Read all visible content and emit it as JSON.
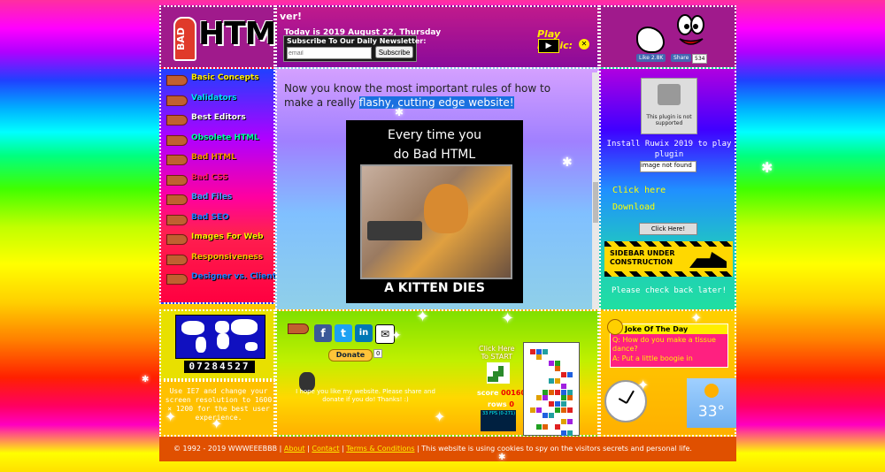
{
  "header": {
    "logo_badge": "BAD",
    "logo_word": "HTML",
    "scroll_text": "ver!",
    "date_text": "Today is 2019 August 22, Thursday",
    "newsletter": {
      "title": "Subscribe To Our Daily Newsletter:",
      "placeholder": "email",
      "button": "Subscribe"
    },
    "music_label": "Play Music:",
    "play_icon": "play-icon",
    "stop_icon": "close-icon",
    "like_label": "Like 2.8K",
    "share_label": "Share",
    "share_count": "534"
  },
  "nav": {
    "items": [
      {
        "label": "Basic Concepts",
        "color": "#ffee00"
      },
      {
        "label": "Validators",
        "color": "#00e0ff"
      },
      {
        "label": "Best Editors",
        "color": "#ffffff"
      },
      {
        "label": "Obsolete HTML",
        "color": "#00ffa0"
      },
      {
        "label": "Bad HTML",
        "color": "#ff9000"
      },
      {
        "label": "Bad CSS",
        "color": "#ff2060"
      },
      {
        "label": "Bad Files",
        "color": "#40a0ff"
      },
      {
        "label": "Bad SEO",
        "color": "#2080ff"
      },
      {
        "label": "Images For Web",
        "color": "#ffee00"
      },
      {
        "label": "Responsiveness",
        "color": "#ffc000"
      },
      {
        "label": "Designer vs. Client",
        "color": "#2080ff"
      }
    ]
  },
  "main": {
    "intro_plain": "Now you know the most important rules of how to make a really ",
    "intro_highlight": "flashy, cutting edge website!",
    "meme_top_1": "Every time you",
    "meme_top_2": "do Bad HTML",
    "meme_bottom": "A KITTEN DIES"
  },
  "sidebar": {
    "plugin_text": "This plugin is not supported",
    "install_text": "Install Ruwix 2019 to play plugin",
    "image_not_found": "image not found",
    "click_here": "Click here",
    "download": "Download",
    "click_button": "Click Here!",
    "construction_1": "SIDEBAR UNDER",
    "construction_2": "CONSTRUCTION",
    "check_back": "Please check back later!"
  },
  "bottom": {
    "counter": "07284527",
    "ie7_text": "Use IE7 and change your screen resolution to 1600 × 1200 for the best user experience.",
    "donate": "Donate",
    "donate_count": "0",
    "hope_text": "I hope you like my website. Please share and donate if you do! Thanks! :)",
    "tetris_label_1": "Click Here",
    "tetris_label_2": "To START",
    "score_label": "score",
    "score_value": "00160",
    "rows_label": "rows",
    "rows_value": "0",
    "fps_text": "33 FPS (0-271)",
    "joke_title": "Joke Of The Day",
    "joke_q": "Q: How do you make a tissue dance?",
    "joke_a": "A: Put a little boogie in",
    "temperature": "33°"
  },
  "footer": {
    "copyright": "© 1992 - 2019 WWWEEEBBB |",
    "about": "About",
    "contact": "Contact",
    "terms": "Terms & Conditions",
    "notice": "| This website is using cookies to spy on the visitors secrets and personal life."
  }
}
